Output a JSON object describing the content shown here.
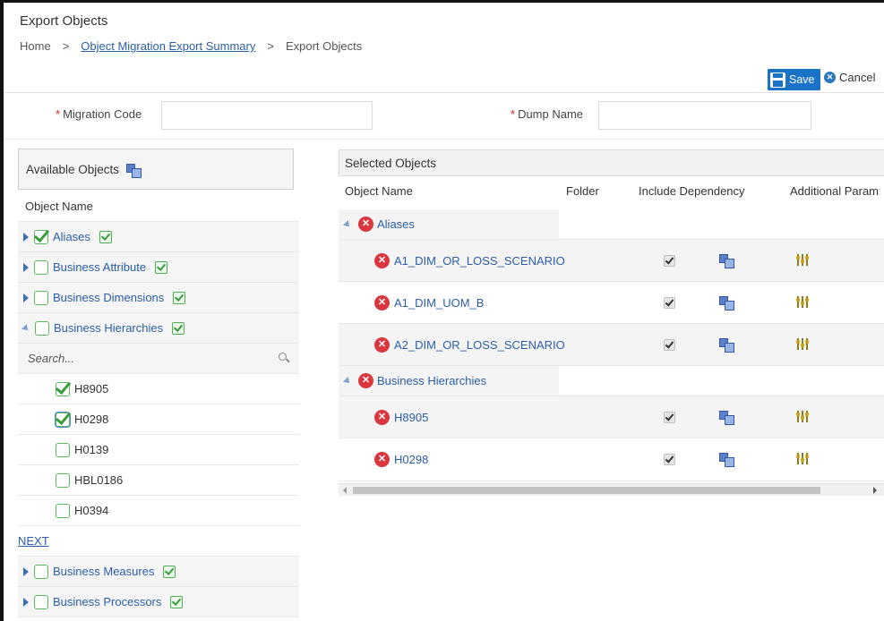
{
  "page": {
    "title": "Export Objects",
    "breadcrumb": {
      "home": "Home",
      "link": "Object Migration Export Summary",
      "current": "Export Objects",
      "separator": ">"
    }
  },
  "toolbar": {
    "save_label": "Save",
    "cancel_label": "Cancel"
  },
  "form": {
    "migration_code_label": "Migration Code",
    "migration_code_value": "",
    "dump_name_label": "Dump Name",
    "dump_name_value": "",
    "required_mark": "*"
  },
  "available": {
    "header": "Available Objects",
    "column": "Object Name",
    "search_placeholder": "Search...",
    "next_label": "NEXT",
    "groups": [
      {
        "label": "Aliases",
        "checked": true
      },
      {
        "label": "Business Attribute",
        "checked": false
      },
      {
        "label": "Business Dimensions",
        "checked": false
      },
      {
        "label": "Business Hierarchies",
        "checked": false
      },
      {
        "label": "Business Measures",
        "checked": false
      },
      {
        "label": "Business Processors",
        "checked": false
      }
    ],
    "children": [
      {
        "label": "H8905",
        "checked": true
      },
      {
        "label": "H0298",
        "checked": true
      },
      {
        "label": "H0139",
        "checked": false
      },
      {
        "label": "HBL0186",
        "checked": false
      },
      {
        "label": "H0394",
        "checked": false
      }
    ]
  },
  "selected": {
    "header": "Selected Objects",
    "columns": {
      "name": "Object Name",
      "folder": "Folder",
      "dependency": "Include Dependency",
      "params": "Additional Param"
    },
    "groups": [
      {
        "label": "Aliases",
        "items": [
          "A1_DIM_OR_LOSS_SCENARIO",
          "A1_DIM_UOM_B",
          "A2_DIM_OR_LOSS_SCENARIO"
        ]
      },
      {
        "label": "Business Hierarchies",
        "items": [
          "H8905",
          "H0298"
        ]
      }
    ]
  }
}
